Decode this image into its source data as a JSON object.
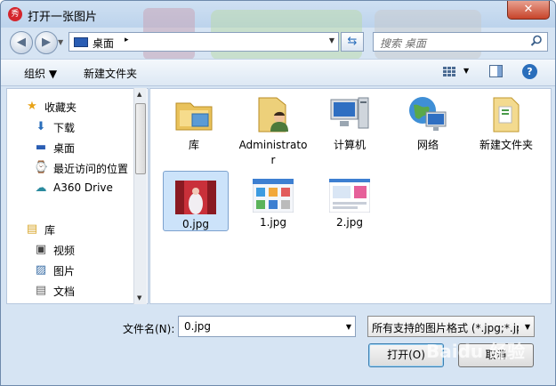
{
  "window": {
    "title": "打开一张图片",
    "app_icon": "qq-photo-app-icon",
    "close_symbol": "✕"
  },
  "navbar": {
    "back_symbol": "◀",
    "forward_symbol": "▶",
    "history_dropdown_symbol": "▼",
    "address": {
      "location": "桌面",
      "separator": "▸",
      "dropdown_symbol": "▼"
    },
    "refresh_symbol": "⇆",
    "search": {
      "placeholder": "搜索 桌面",
      "icon": "magnifier"
    }
  },
  "toolbar": {
    "organize_label": "组织 ▼",
    "new_folder_label": "新建文件夹",
    "view_caret": "▼",
    "help_symbol": "?"
  },
  "nav_pane": {
    "items": [
      {
        "label": "收藏夹",
        "icon": "star-icon",
        "glyph": "★"
      },
      {
        "label": "下载",
        "icon": "download-folder-icon",
        "glyph": "⬇"
      },
      {
        "label": "桌面",
        "icon": "desktop-icon",
        "glyph": "▬"
      },
      {
        "label": "最近访问的位置",
        "icon": "recent-places-icon",
        "glyph": "⌚"
      },
      {
        "label": "A360 Drive",
        "icon": "cloud-drive-icon",
        "glyph": "☁"
      },
      {
        "label": "库",
        "icon": "library-icon",
        "glyph": "▤"
      },
      {
        "label": "视频",
        "icon": "video-icon",
        "glyph": "▣"
      },
      {
        "label": "图片",
        "icon": "pictures-icon",
        "glyph": "▨"
      },
      {
        "label": "文档",
        "icon": "documents-icon",
        "glyph": "▤"
      }
    ]
  },
  "files": [
    {
      "label": "库",
      "icon": "library-folder-icon"
    },
    {
      "label": "Administrator",
      "icon": "user-folder-icon"
    },
    {
      "label": "计算机",
      "icon": "computer-icon"
    },
    {
      "label": "网络",
      "icon": "network-globe-icon"
    },
    {
      "label": "新建文件夹",
      "icon": "folder-icon"
    },
    {
      "label": "0.jpg",
      "icon": "image-thumbnail-icon",
      "selected": true
    },
    {
      "label": "1.jpg",
      "icon": "image-thumbnail-icon"
    },
    {
      "label": "2.jpg",
      "icon": "image-thumbnail-icon"
    }
  ],
  "bottom": {
    "filename_label": "文件名(N):",
    "filename_value": "0.jpg",
    "filter_value": "所有支持的图片格式 (*.jpg;*.jp",
    "open_label": "打开(O)",
    "cancel_label": "取消",
    "dropdown_symbol": "▼"
  },
  "watermark": "Baidu 经验",
  "colors": {
    "accent": "#2a6ebb",
    "selection": "#cce3fa",
    "chrome": "#d6e4f3"
  }
}
